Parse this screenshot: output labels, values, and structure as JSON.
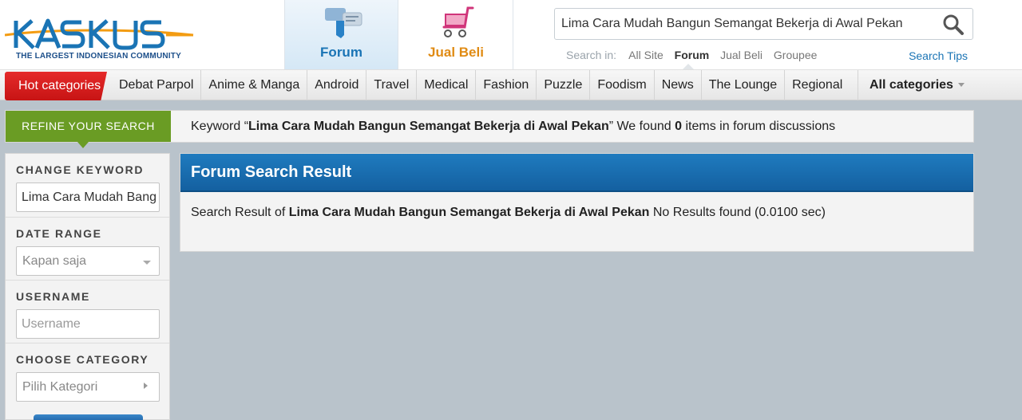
{
  "header": {
    "logo_text": "KASKUS",
    "tagline": "THE LARGEST INDONESIAN COMMUNITY",
    "tabs": [
      {
        "label": "Forum",
        "icon": "forum-icon",
        "active": true
      },
      {
        "label": "Jual Beli",
        "icon": "shopping-cart-icon",
        "active": false
      }
    ],
    "search": {
      "value": "Lima Cara Mudah Bangun Semangat Bekerja di Awal Pekan",
      "icon": "search-icon"
    },
    "search_in": {
      "label": "Search in:",
      "options": [
        "All Site",
        "Forum",
        "Jual Beli",
        "Groupee"
      ],
      "active": "Forum"
    },
    "search_tips": "Search Tips"
  },
  "categories": {
    "hot": "Hot categories",
    "items": [
      "Debat Parpol",
      "Anime & Manga",
      "Android",
      "Travel",
      "Medical",
      "Fashion",
      "Puzzle",
      "Foodism",
      "News",
      "The Lounge",
      "Regional"
    ],
    "all": "All categories"
  },
  "refine": {
    "tab": "REFINE YOUR SEARCH",
    "keyword_prefix": "Keyword “",
    "keyword": "Lima Cara Mudah Bangun Semangat Bekerja di Awal Pekan",
    "keyword_mid": "” We found ",
    "count": "0",
    "keyword_suffix": " items in forum discussions"
  },
  "sidebar": {
    "change_keyword": {
      "title": "CHANGE KEYWORD",
      "value": "Lima Cara Mudah Bangun Semangat Bekerja di Awal Pekan"
    },
    "date_range": {
      "title": "DATE RANGE",
      "selected": "Kapan saja"
    },
    "username": {
      "title": "USERNAME",
      "placeholder": "Username"
    },
    "category": {
      "title": "CHOOSE CATEGORY",
      "selected": "Pilih Kategori"
    }
  },
  "result": {
    "title": "Forum Search Result",
    "prefix": "Search Result of ",
    "keyword": "Lima Cara Mudah Bangun Semangat Bekerja di Awal Pekan",
    "suffix": " No Results found (0.0100 sec)"
  },
  "colors": {
    "brand_blue": "#1a74b5",
    "jualbeli_orange": "#e08b14",
    "hot_red": "#d41e1e",
    "refine_green": "#6a9c24",
    "page_bg": "#b9c3cb"
  }
}
